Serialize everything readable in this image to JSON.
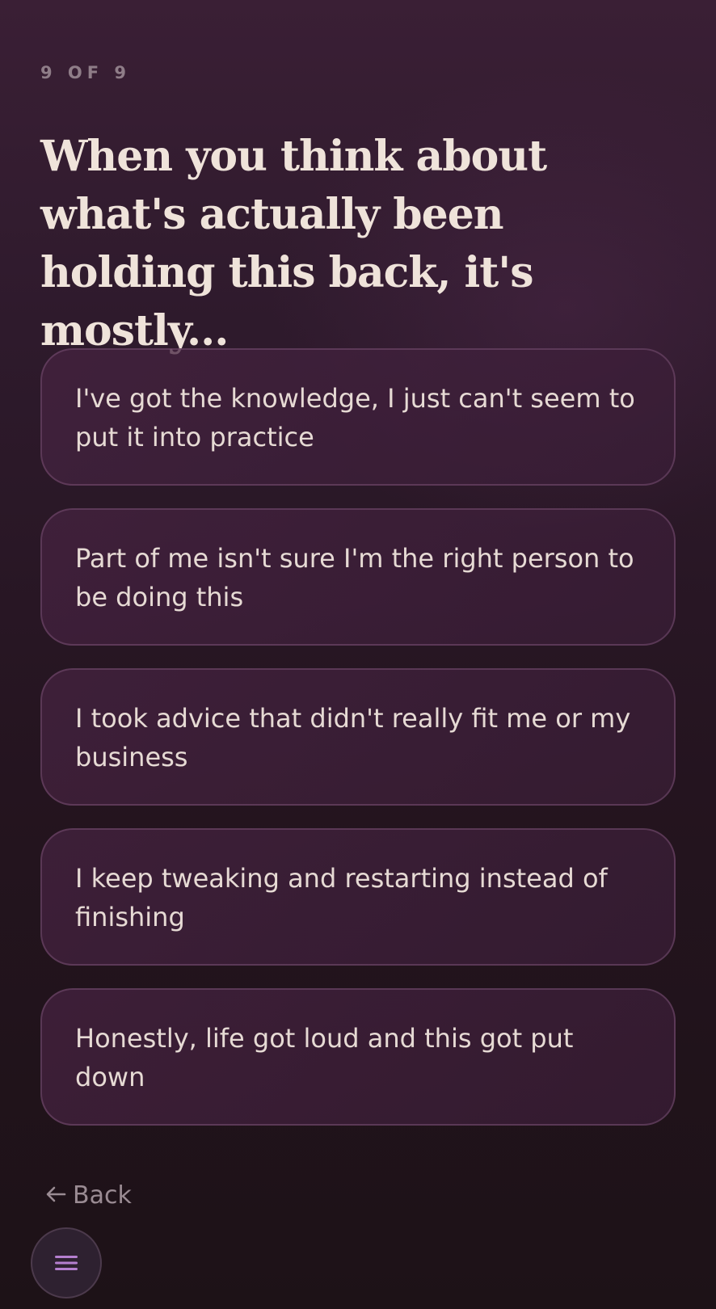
{
  "progress": {
    "label": "9 OF 9",
    "current": 9,
    "total": 9
  },
  "question": {
    "text": "When you think about what's actually been holding this back, it's mostly..."
  },
  "options": [
    {
      "label": "I've got the knowledge, I just can't seem to put it into practice"
    },
    {
      "label": "Part of me isn't sure I'm the right person to be doing this"
    },
    {
      "label": "I took advice that didn't really fit me or my business"
    },
    {
      "label": "I keep tweaking and restarting instead of finishing"
    },
    {
      "label": "Honestly, life got loud and this got put down"
    }
  ],
  "navigation": {
    "back_label": "Back",
    "back_icon": "arrow-left-icon",
    "menu_icon": "hamburger-menu-icon"
  },
  "colors": {
    "background_top": "#3a1f35",
    "background_bottom": "#1d1217",
    "card_border": "#6e4a68",
    "text_primary": "#efe3da",
    "text_muted": "#9a8b93",
    "menu_accent": "#b57fcf"
  }
}
